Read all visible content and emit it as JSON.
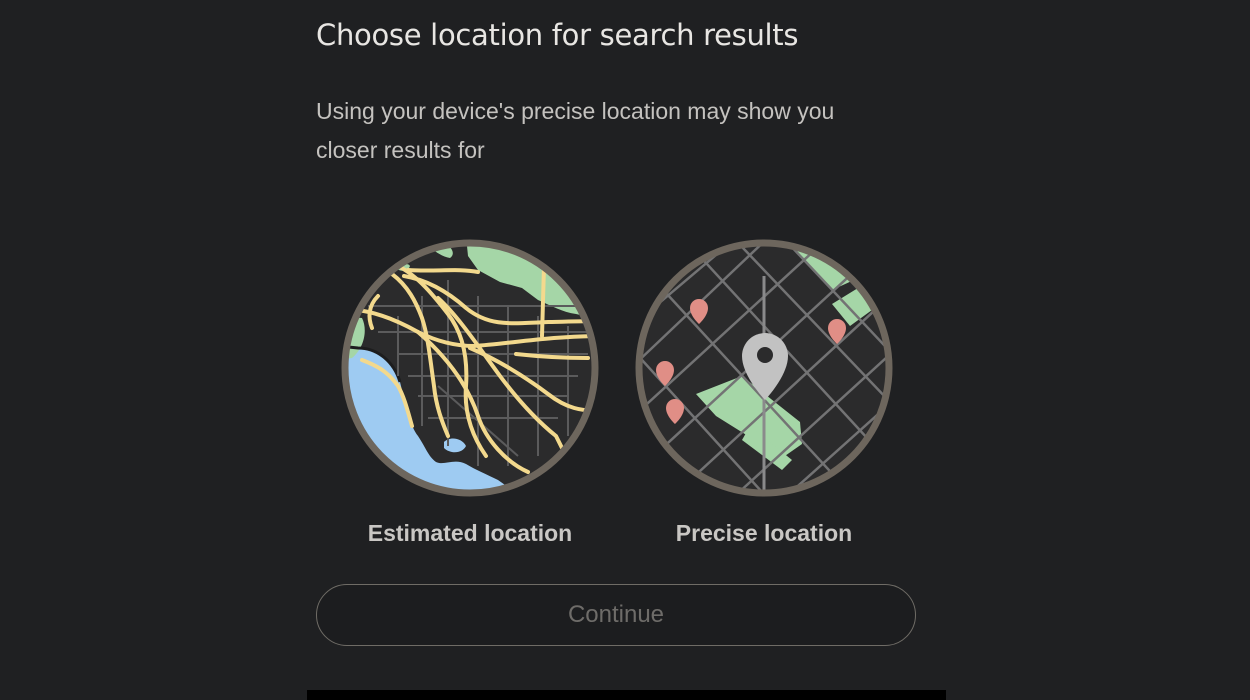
{
  "title": "Choose location for search results",
  "description": "Using your device's precise location may show you closer results for",
  "options": [
    {
      "label": "Estimated location",
      "icon": "estimated-location-map-icon"
    },
    {
      "label": "Precise location",
      "icon": "precise-location-map-icon"
    }
  ],
  "continue_button": {
    "label": "Continue",
    "enabled": false
  },
  "colors": {
    "background": "#1f2022",
    "map_ring": "#6d665d",
    "map_land": "#2b2b2c",
    "map_water": "#9ecbf2",
    "map_park": "#a5d6a7",
    "map_highway": "#f3d98d",
    "map_pin": "#e08e86",
    "center_pin": "#c2c2c2"
  }
}
